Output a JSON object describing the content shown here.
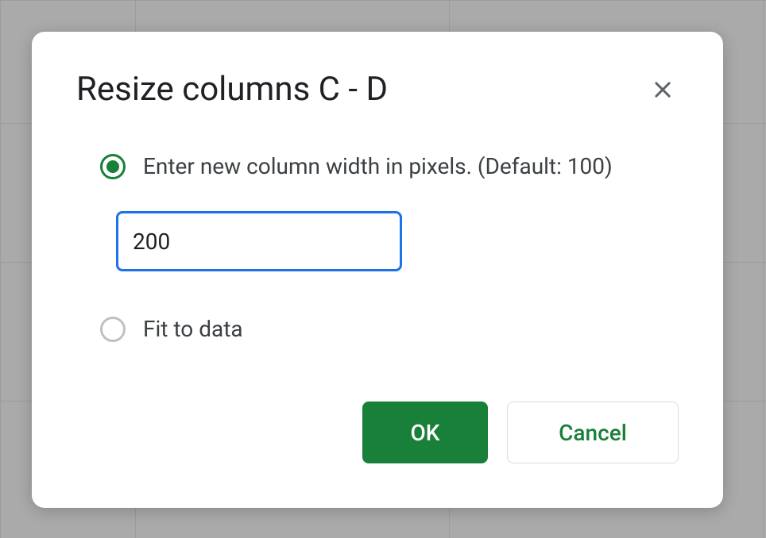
{
  "dialog": {
    "title": "Resize columns C - D",
    "options": {
      "enter_width": {
        "label": "Enter new column width in pixels. (Default: 100)",
        "selected": true
      },
      "fit_to_data": {
        "label": "Fit to data",
        "selected": false
      }
    },
    "input": {
      "value": "200"
    },
    "buttons": {
      "ok": "OK",
      "cancel": "Cancel"
    }
  }
}
